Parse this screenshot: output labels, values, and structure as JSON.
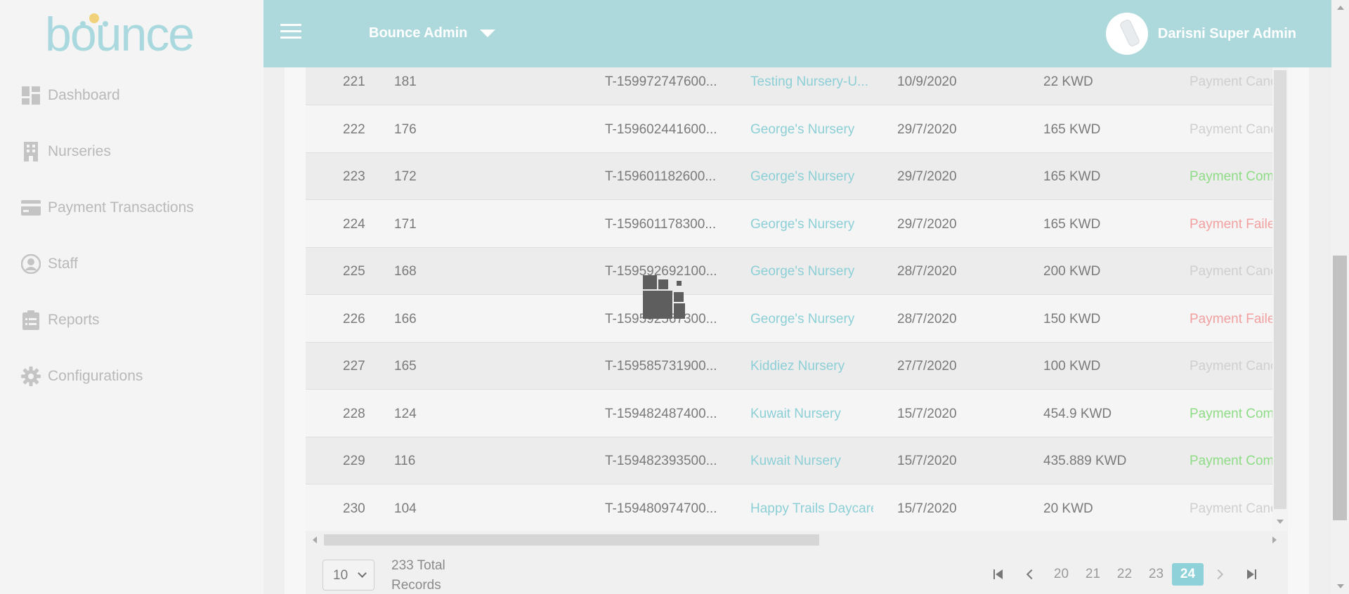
{
  "app": {
    "logo_text": "bounce",
    "brand_color": "#a9d9de"
  },
  "sidebar": {
    "items": [
      {
        "label": "Dashboard",
        "icon": "dashboard-icon"
      },
      {
        "label": "Nurseries",
        "icon": "building-icon"
      },
      {
        "label": "Payment Transactions",
        "icon": "credit-card-icon"
      },
      {
        "label": "Staff",
        "icon": "user-circle-icon"
      },
      {
        "label": "Reports",
        "icon": "clipboard-icon"
      },
      {
        "label": "Configurations",
        "icon": "gear-icon"
      }
    ]
  },
  "header": {
    "menu_icon": "hamburger-icon",
    "org_label": "Bounce Admin",
    "user_name": "Darisni Super Admin"
  },
  "table": {
    "rows": [
      {
        "index": "221",
        "id": "181",
        "transaction": "T-159972747600...",
        "nursery": "Testing Nursery-U...",
        "date": "10/9/2020",
        "amount": "22 KWD",
        "status": "Payment Canc",
        "status_type": "cancelled"
      },
      {
        "index": "222",
        "id": "176",
        "transaction": "T-159602441600...",
        "nursery": "George's Nursery",
        "date": "29/7/2020",
        "amount": "165 KWD",
        "status": "Payment Canc",
        "status_type": "cancelled"
      },
      {
        "index": "223",
        "id": "172",
        "transaction": "T-159601182600...",
        "nursery": "George's Nursery",
        "date": "29/7/2020",
        "amount": "165 KWD",
        "status": "Payment Comp",
        "status_type": "completed"
      },
      {
        "index": "224",
        "id": "171",
        "transaction": "T-159601178300...",
        "nursery": "George's Nursery",
        "date": "29/7/2020",
        "amount": "165 KWD",
        "status": "Payment Faile",
        "status_type": "failed"
      },
      {
        "index": "225",
        "id": "168",
        "transaction": "T-159592692100...",
        "nursery": "George's Nursery",
        "date": "28/7/2020",
        "amount": "200 KWD",
        "status": "Payment Canc",
        "status_type": "cancelled"
      },
      {
        "index": "226",
        "id": "166",
        "transaction": "T-159592567300...",
        "nursery": "George's Nursery",
        "date": "28/7/2020",
        "amount": "150 KWD",
        "status": "Payment Faile",
        "status_type": "failed"
      },
      {
        "index": "227",
        "id": "165",
        "transaction": "T-159585731900...",
        "nursery": "Kiddiez Nursery",
        "date": "27/7/2020",
        "amount": "100 KWD",
        "status": "Payment Canc",
        "status_type": "cancelled"
      },
      {
        "index": "228",
        "id": "124",
        "transaction": "T-159482487400...",
        "nursery": "Kuwait Nursery",
        "date": "15/7/2020",
        "amount": "454.9 KWD",
        "status": "Payment Comp",
        "status_type": "completed"
      },
      {
        "index": "229",
        "id": "116",
        "transaction": "T-159482393500...",
        "nursery": "Kuwait Nursery",
        "date": "15/7/2020",
        "amount": "435.889 KWD",
        "status": "Payment Comp",
        "status_type": "completed"
      },
      {
        "index": "230",
        "id": "104",
        "transaction": "T-159480974700...",
        "nursery": "Happy Trails Daycare",
        "date": "15/7/2020",
        "amount": "20 KWD",
        "status": "Payment Canc",
        "status_type": "cancelled"
      }
    ],
    "status_colors": {
      "cancelled": "#cfcfcf",
      "completed": "#8fdc86",
      "failed": "#f2a0a0"
    }
  },
  "pagination": {
    "per_page": "10",
    "total_line1": "233 Total",
    "total_line2": "Records",
    "pages": [
      "20",
      "21",
      "22",
      "23",
      "24"
    ],
    "active_page": "24"
  }
}
